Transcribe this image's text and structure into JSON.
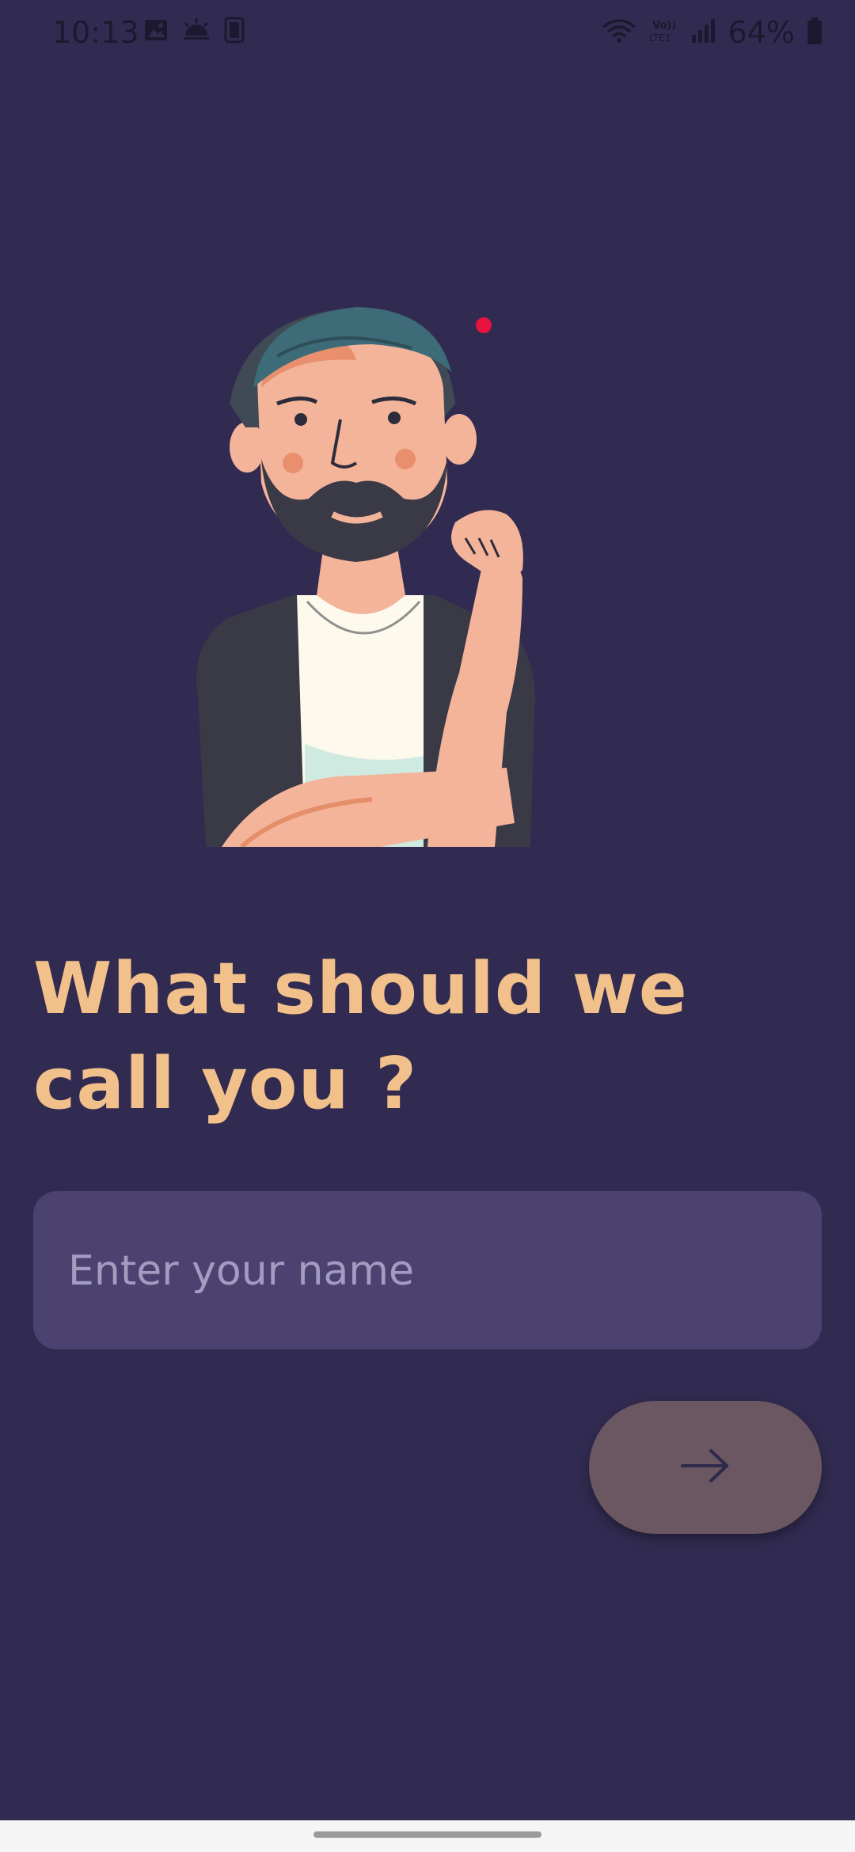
{
  "status_bar": {
    "time": "10:13",
    "battery": "64%",
    "left_icons": [
      "image-icon",
      "weather-icon",
      "clipboard-icon"
    ],
    "right_icons": [
      "wifi-icon",
      "volte-icon",
      "signal-icon",
      "battery-icon"
    ]
  },
  "main": {
    "heading_line1": "What should we",
    "heading_line2": "call you ?",
    "name_input": {
      "placeholder": "Enter your name",
      "value": ""
    },
    "next_button_icon": "arrow-right-icon"
  },
  "colors": {
    "background": "#322b51",
    "heading": "#f2c08a",
    "input_bg": "#4b4270",
    "button_bg": "#6a5762",
    "accent_dot": "#e8123f"
  }
}
